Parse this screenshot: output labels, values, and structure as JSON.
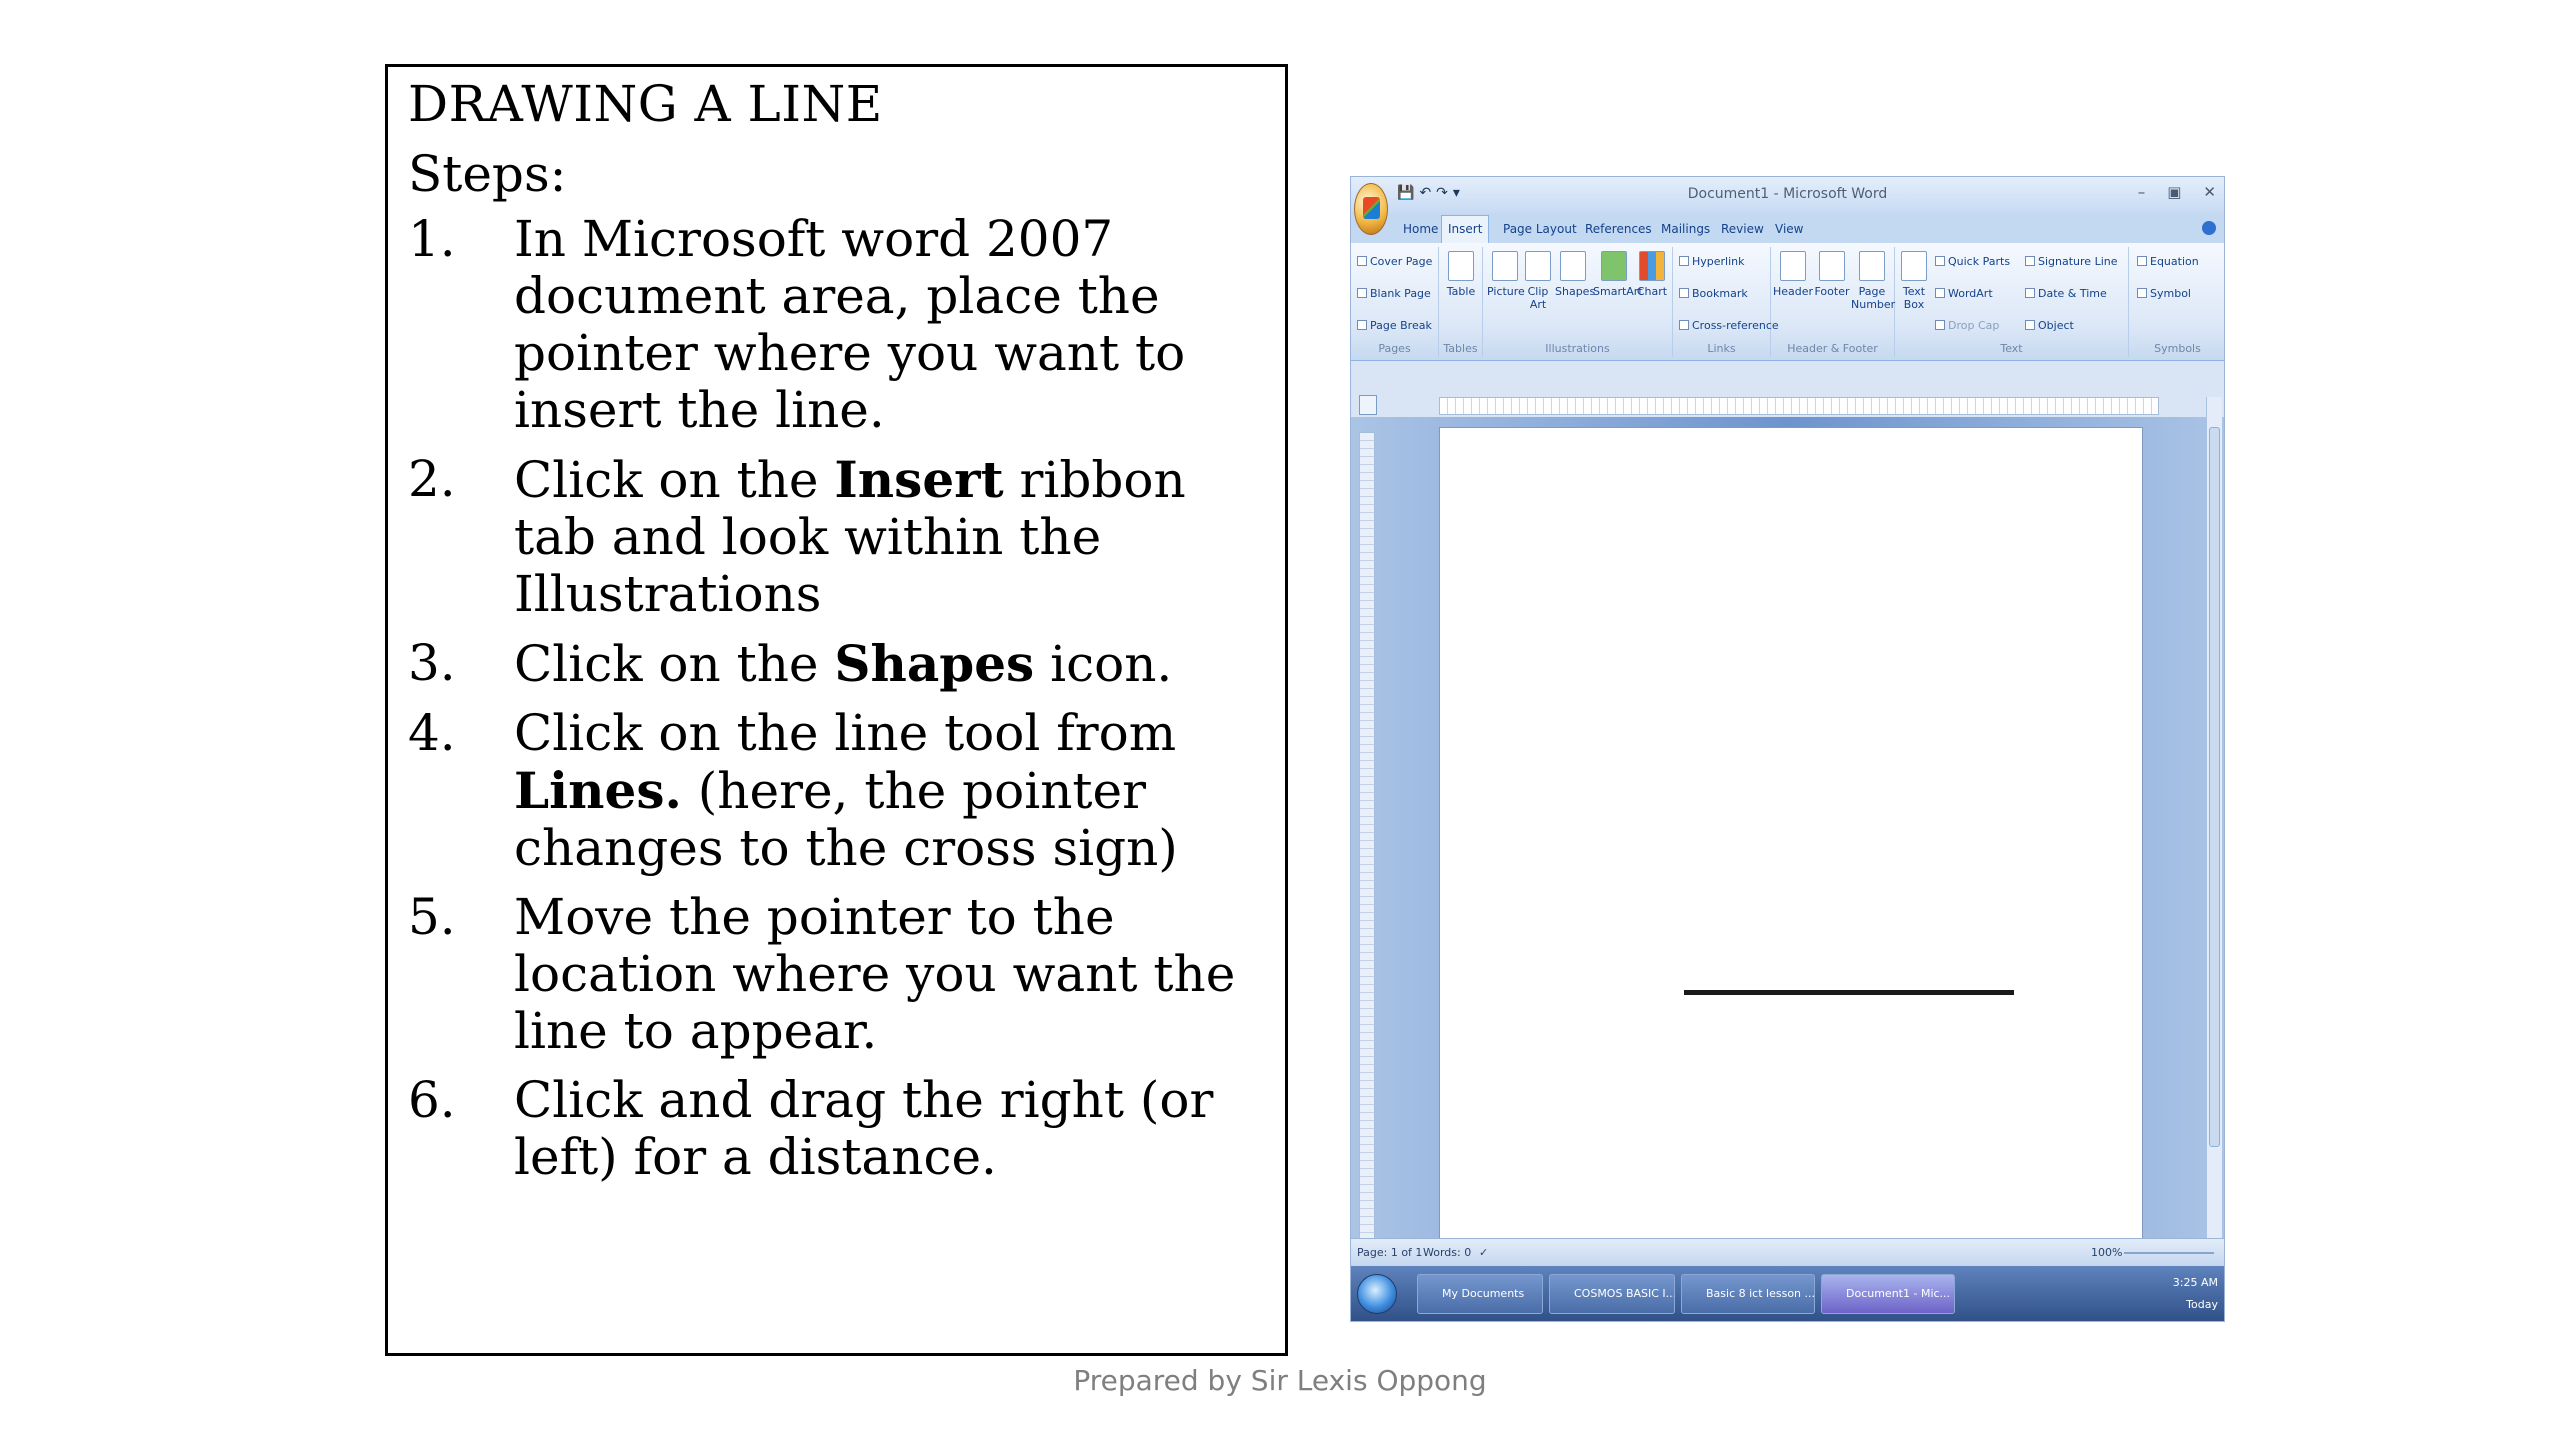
{
  "slide": {
    "title": "DRAWING A LINE",
    "steps_label": "Steps:",
    "steps": [
      {
        "num": "1.",
        "parts": [
          "In Microsoft word 2007 document area, place the pointer where you want to insert the line."
        ]
      },
      {
        "num": "2.",
        "parts": [
          "Click on the ",
          "Insert",
          " ribbon tab and look within the Illustrations"
        ]
      },
      {
        "num": "3.",
        "parts": [
          "Click on the ",
          "Shapes",
          " icon."
        ]
      },
      {
        "num": "4.",
        "parts": [
          "Click on the line tool from ",
          "Lines.",
          " (here, the pointer changes to the cross sign)"
        ]
      },
      {
        "num": "5.",
        "parts": [
          "Move the pointer to the location where you want the line to appear."
        ]
      },
      {
        "num": "6.",
        "parts": [
          "Click and drag the right (or left) for a distance."
        ]
      }
    ],
    "footer": "Prepared by  Sir Lexis Oppong"
  },
  "word": {
    "title": "Document1 - Microsoft Word",
    "tabs": [
      "Home",
      "Insert",
      "Page Layout",
      "References",
      "Mailings",
      "Review",
      "View"
    ],
    "active_tab": "Insert",
    "groups": {
      "pages": {
        "label": "Pages",
        "items": [
          "Cover Page",
          "Blank Page",
          "Page Break"
        ]
      },
      "tables": {
        "label": "Tables",
        "items": [
          "Table"
        ]
      },
      "illustrations": {
        "label": "Illustrations",
        "items": [
          "Picture",
          "Clip Art",
          "Shapes",
          "SmartArt",
          "Chart"
        ]
      },
      "links": {
        "label": "Links",
        "items": [
          "Hyperlink",
          "Bookmark",
          "Cross-reference"
        ]
      },
      "header_footer": {
        "label": "Header & Footer",
        "items": [
          "Header",
          "Footer",
          "Page Number"
        ]
      },
      "text": {
        "label": "Text",
        "items": [
          "Text Box",
          "Quick Parts",
          "WordArt",
          "Drop Cap",
          "Signature Line",
          "Date & Time",
          "Object"
        ]
      },
      "symbols": {
        "label": "Symbols",
        "items": [
          "Equation",
          "Symbol"
        ]
      }
    },
    "status": {
      "page": "Page: 1 of 1",
      "words": "Words: 0",
      "zoom": "100%"
    },
    "taskbar": {
      "buttons": [
        "My Documents",
        "COSMOS BASIC I...",
        "Basic 8 ict lesson ...",
        "Document1 - Mic..."
      ],
      "time": "3:25 AM",
      "day": "Today"
    }
  }
}
